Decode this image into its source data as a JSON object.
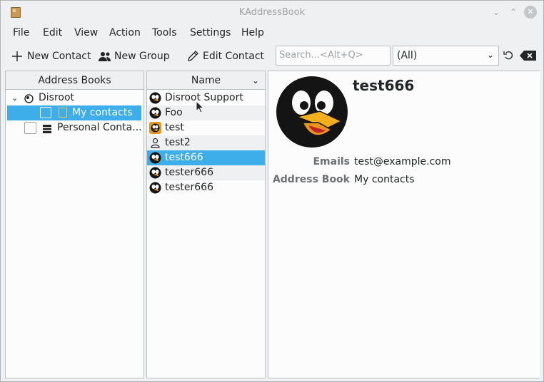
{
  "window": {
    "title": "KAddressBook"
  },
  "menu": [
    "File",
    "Edit",
    "View",
    "Action",
    "Tools",
    "Settings",
    "Help"
  ],
  "toolbar": {
    "new_contact": "New Contact",
    "new_group": "New Group",
    "edit_contact": "Edit Contact",
    "search_placeholder": "Search...<Alt+Q>",
    "filter_value": "(All)"
  },
  "address_books": {
    "header": "Address Books",
    "items": [
      {
        "label": "Disroot",
        "expanded": true
      },
      {
        "label": "My contacts",
        "selected": true
      },
      {
        "label": "Personal Conta..."
      }
    ]
  },
  "contacts": {
    "header": "Name",
    "items": [
      {
        "name": "Disroot Support",
        "avatar": "tux-small-icon"
      },
      {
        "name": "Foo",
        "avatar": "tux-small-icon"
      },
      {
        "name": "test",
        "avatar": "orange-tux-icon"
      },
      {
        "name": "test2",
        "avatar": "person-icon"
      },
      {
        "name": "test666",
        "avatar": "tux-small-icon",
        "selected": true
      },
      {
        "name": "tester666",
        "avatar": "tux-small-icon"
      },
      {
        "name": "tester666",
        "avatar": "tux-small-icon"
      }
    ]
  },
  "detail": {
    "name": "test666",
    "emails_label": "Emails",
    "emails_value": "test@example.com",
    "address_book_label": "Address Book",
    "address_book_value": "My contacts"
  },
  "colors": {
    "accent": "#3daee9",
    "window_bg": "#eff0f1",
    "panel_bg": "#fcfcfc"
  }
}
